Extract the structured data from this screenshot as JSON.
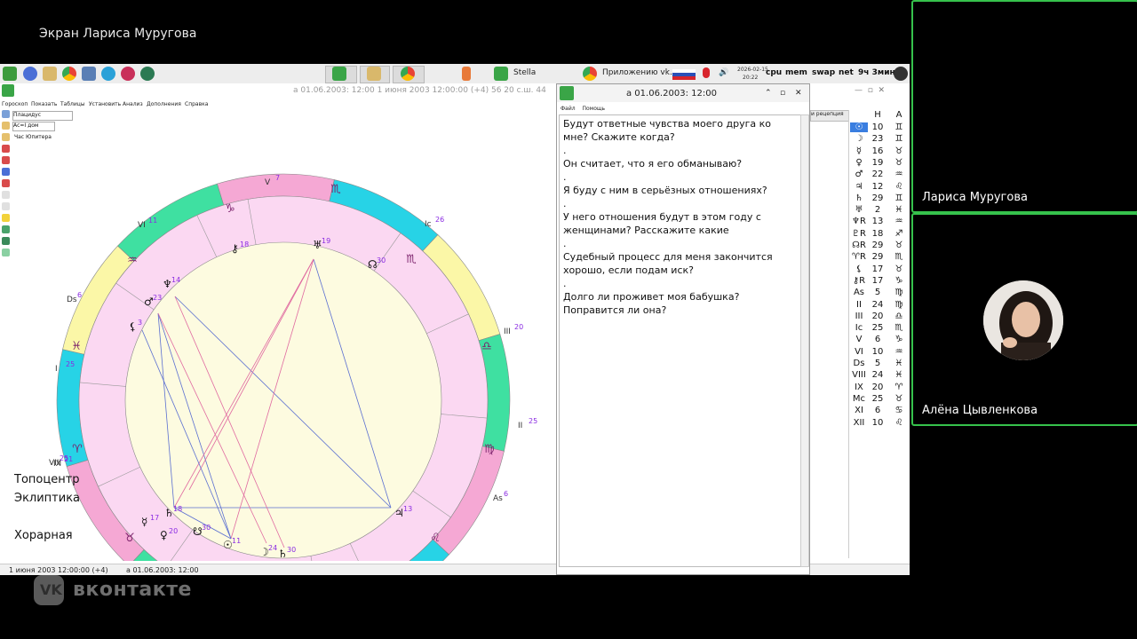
{
  "share": {
    "title": "Экран Лариса Муругова"
  },
  "taskbar": {
    "tasks": [
      "Stella",
      "Приложению vk..."
    ],
    "date": "2026-02-15",
    "time": "20:22",
    "meters": [
      "cpu",
      "mem",
      "swap",
      "net"
    ],
    "uptime": "9ч 3мин",
    "lang_flag": "ru-flag"
  },
  "stella": {
    "title": "а 01.06.2003: 12:00   1 июня 2003 12:00:00 (+4)   56 20 с.ш.   44",
    "menu": [
      "Гороскоп",
      "Показать",
      "Таблицы",
      "Установить",
      "Анализ",
      "Дополнения",
      "Справка"
    ],
    "house_system": "Плацидус",
    "ascendant_combo": "Ас=I дом",
    "planet_hour": "Час Юпитера",
    "labels": {
      "topocenter": "Топоцентр",
      "ecliptic": "Эклиптика",
      "horary": "Хорарная"
    },
    "status": {
      "left": "1 июня 2003  12:00:00 (+4)",
      "right": "а 01.06.2003: 12:00"
    },
    "reception_tab": "и рецепция",
    "chart": {
      "houses": [
        {
          "name": "I",
          "deg": "25"
        },
        {
          "name": "II",
          "deg": "25"
        },
        {
          "name": "III",
          "deg": "20"
        },
        {
          "name": "Ic",
          "deg": "26"
        },
        {
          "name": "V",
          "deg": "7"
        },
        {
          "name": "VI",
          "deg": "11"
        },
        {
          "name": "Ds",
          "deg": "6"
        },
        {
          "name": "VIII",
          "deg": "25"
        },
        {
          "name": "IX",
          "deg": "21"
        },
        {
          "name": "Mc",
          "deg": "26"
        },
        {
          "name": "XI",
          "deg": "7"
        },
        {
          "name": "XII",
          "deg": "11"
        },
        {
          "name": "As",
          "deg": "6"
        }
      ],
      "planets": [
        {
          "glyph": "⚷",
          "deg": "18"
        },
        {
          "glyph": "♅",
          "deg": "19"
        },
        {
          "glyph": "☊",
          "deg": "30"
        },
        {
          "glyph": "♆",
          "deg": "14"
        },
        {
          "glyph": "♂",
          "deg": "23"
        },
        {
          "glyph": "⚸",
          "deg": "3"
        },
        {
          "glyph": "♃",
          "deg": "13"
        },
        {
          "glyph": "☿",
          "deg": "17"
        },
        {
          "glyph": "♀",
          "deg": "20"
        },
        {
          "glyph": "♄",
          "deg": "18"
        },
        {
          "glyph": "☋",
          "deg": "30"
        },
        {
          "glyph": "☉",
          "deg": "11"
        },
        {
          "glyph": "☽",
          "deg": "24"
        },
        {
          "glyph": "♄",
          "deg": "30"
        }
      ]
    }
  },
  "dialog": {
    "title": "а 01.06.2003: 12:00",
    "menu": [
      "Файл",
      "Помощь"
    ],
    "paragraphs": [
      "Будут ответные чувства моего друга ко мне? Скажите когда?",
      ".",
      "Он считает, что я его обманываю?",
      ".",
      "Я буду с ним в серьёзных отношениях?",
      ".",
      "У него отношения будут в этом году с женщинами? Расскажите какие",
      ".",
      "Судебный процесс для меня закончится хорошо, если подам иск?",
      ".",
      "Долго ли проживет моя бабушка? Поправится ли она?"
    ]
  },
  "table": {
    "header": [
      "",
      "Н",
      "А"
    ],
    "rows": [
      [
        "☉",
        "10",
        "♊"
      ],
      [
        "☽",
        "23",
        "♊"
      ],
      [
        "☿",
        "16",
        "♉"
      ],
      [
        "♀",
        "19",
        "♉"
      ],
      [
        "♂",
        "22",
        "♒"
      ],
      [
        "♃",
        "12",
        "♌"
      ],
      [
        "♄",
        "29",
        "♊"
      ],
      [
        "♅",
        "2",
        "♓"
      ],
      [
        "♆R",
        "13",
        "♒"
      ],
      [
        "♇R",
        "18",
        "♐"
      ],
      [
        "☊R",
        "29",
        "♉"
      ],
      [
        "♈R",
        "29",
        "♏"
      ],
      [
        "⚸",
        "17",
        "♉"
      ],
      [
        "⚷R",
        "17",
        "♑"
      ],
      [
        "As",
        "5",
        "♍"
      ],
      [
        "II",
        "24",
        "♍"
      ],
      [
        "III",
        "20",
        "♎"
      ],
      [
        "Ic",
        "25",
        "♏"
      ],
      [
        "V",
        "6",
        "♑"
      ],
      [
        "VI",
        "10",
        "♒"
      ],
      [
        "Ds",
        "5",
        "♓"
      ],
      [
        "VIII",
        "24",
        "♓"
      ],
      [
        "IX",
        "20",
        "♈"
      ],
      [
        "Mc",
        "25",
        "♉"
      ],
      [
        "XI",
        "6",
        "♋"
      ],
      [
        "XII",
        "10",
        "♌"
      ]
    ]
  },
  "participants": [
    {
      "name": "Лариса Муругова"
    },
    {
      "name": "Алёна Цывленкова"
    }
  ],
  "brand": {
    "name": "вконтакте"
  },
  "colors": {
    "active_border": "#36c24c",
    "pink_sector": "#f5a8d4",
    "cyan_sector": "#27d3e6",
    "yellow_sector": "#fbf7a7",
    "green_sector": "#3fe0a1"
  }
}
